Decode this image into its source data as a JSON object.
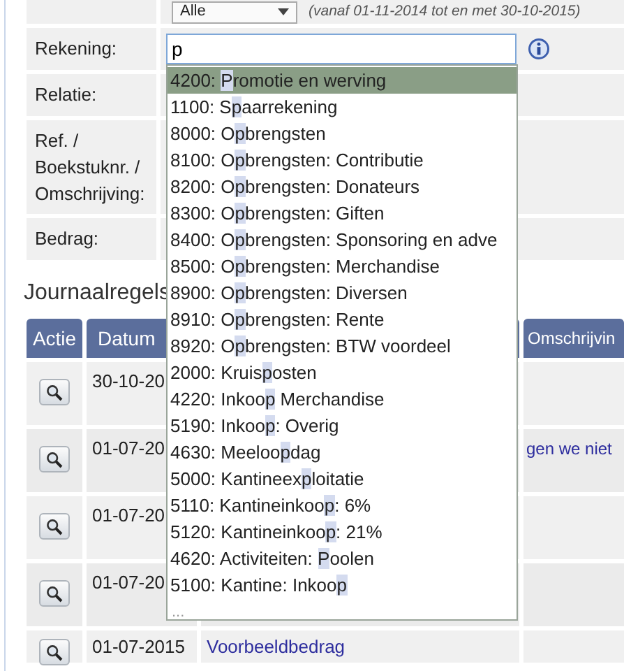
{
  "filter": {
    "select": "Alle",
    "period": "(vanaf 01-11-2014 tot en met 30-10-2015)"
  },
  "fields": [
    {
      "kind": "account",
      "label": "Rekening:",
      "value": "p"
    },
    {
      "kind": "plain",
      "label": "Relatie:"
    },
    {
      "kind": "plain",
      "label": "Ref. / Boekstuknr. / Omschrijving:"
    },
    {
      "kind": "plain",
      "label": "Bedrag:"
    }
  ],
  "suggestions": [
    {
      "before": "4200: ",
      "match": "P",
      "after": "romotie en werving",
      "selected": true
    },
    {
      "before": "1100: S",
      "match": "p",
      "after": "aarrekening",
      "selected": false
    },
    {
      "before": "8000: O",
      "match": "p",
      "after": "brengsten",
      "selected": false
    },
    {
      "before": "8100: O",
      "match": "p",
      "after": "brengsten: Contributie",
      "selected": false
    },
    {
      "before": "8200: O",
      "match": "p",
      "after": "brengsten: Donateurs",
      "selected": false
    },
    {
      "before": "8300: O",
      "match": "p",
      "after": "brengsten: Giften",
      "selected": false
    },
    {
      "before": "8400: O",
      "match": "p",
      "after": "brengsten: Sponsoring en adve",
      "selected": false
    },
    {
      "before": "8500: O",
      "match": "p",
      "after": "brengsten: Merchandise",
      "selected": false
    },
    {
      "before": "8900: O",
      "match": "p",
      "after": "brengsten: Diversen",
      "selected": false
    },
    {
      "before": "8910: O",
      "match": "p",
      "after": "brengsten: Rente",
      "selected": false
    },
    {
      "before": "8920: O",
      "match": "p",
      "after": "brengsten: BTW voordeel",
      "selected": false
    },
    {
      "before": "2000: Kruis",
      "match": "p",
      "after": "osten",
      "selected": false
    },
    {
      "before": "4220: Inkoo",
      "match": "p",
      "after": " Merchandise",
      "selected": false
    },
    {
      "before": "5190: Inkoo",
      "match": "p",
      "after": ": Overig",
      "selected": false
    },
    {
      "before": "4630: Meeloo",
      "match": "p",
      "after": "dag",
      "selected": false
    },
    {
      "before": "5000: Kantineex",
      "match": "p",
      "after": "loitatie",
      "selected": false
    },
    {
      "before": "5110: Kantineinkoo",
      "match": "p",
      "after": ": 6%",
      "selected": false
    },
    {
      "before": "5120: Kantineinkoo",
      "match": "p",
      "after": ": 21%",
      "selected": false
    },
    {
      "before": "4620: Activiteiten: ",
      "match": "P",
      "after": "oolen",
      "selected": false
    },
    {
      "before": "5100: Kantine: Inkoo",
      "match": "p",
      "selected": false
    }
  ],
  "suggestions_more": "...",
  "journal": {
    "heading": "Journaalregels",
    "columns": [
      "Actie",
      "Datum",
      "Omschrijvin"
    ],
    "rows": [
      {
        "date": "30-10-20"
      },
      {
        "date": "01-07-20",
        "omschrijving": "gen we niet"
      },
      {
        "date": "01-07-20"
      },
      {
        "date": "01-07-20"
      },
      {
        "date": "01-07-2015",
        "column_3": "Voorbeeldbedrag"
      }
    ]
  }
}
